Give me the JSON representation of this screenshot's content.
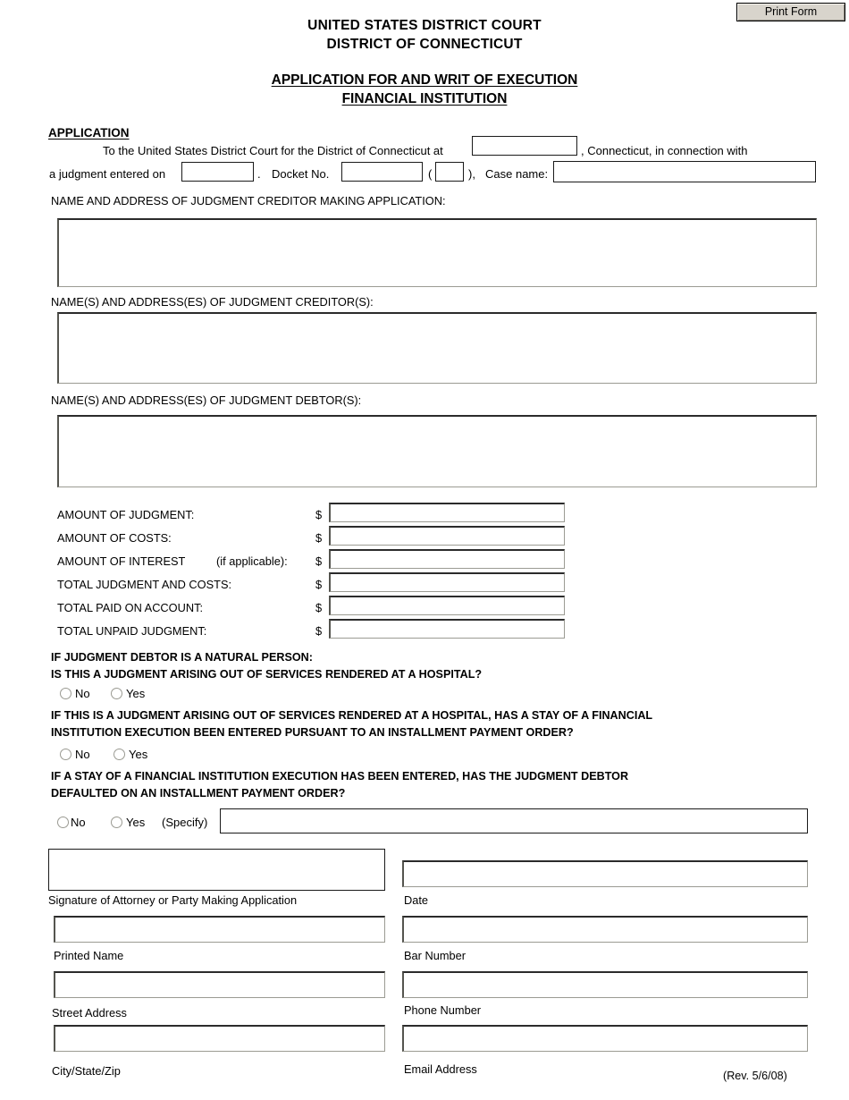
{
  "toolbar": {
    "print_form_label": "Print Form"
  },
  "header": {
    "court_line1": "UNITED STATES DISTRICT COURT",
    "court_line2": "DISTRICT OF CONNECTICUT",
    "form_title_line1": "APPLICATION FOR AND WRIT OF EXECUTION",
    "form_title_line2": "FINANCIAL INSTITUTION"
  },
  "application": {
    "section_heading": "APPLICATION",
    "intro_text": "To the United States District Court for the District of Connecticut at",
    "intro_after_city": ", Connecticut, in connection with",
    "judgment_entered_label": "a judgment entered on",
    "period": ".",
    "docket_label": "Docket No.",
    "paren_open": "(",
    "paren_close": "),",
    "case_name_label": "Case name:",
    "city_value": "",
    "judgment_date_value": "",
    "docket_no_value": "",
    "docket_suffix_value": "",
    "case_name_value": ""
  },
  "parties": {
    "creditor_applicant_label": "NAME AND ADDRESS OF JUDGMENT CREDITOR MAKING APPLICATION:",
    "creditor_applicant_value": "",
    "creditors_label": "NAME(S) AND ADDRESS(ES) OF JUDGMENT CREDITOR(S):",
    "creditors_value": "",
    "debtors_label": "NAME(S) AND ADDRESS(ES) OF JUDGMENT DEBTOR(S):",
    "debtors_value": ""
  },
  "amounts": {
    "currency_symbol": "$",
    "rows": [
      {
        "label": "AMOUNT OF JUDGMENT:",
        "note": "",
        "value": ""
      },
      {
        "label": "AMOUNT OF COSTS:",
        "note": "",
        "value": ""
      },
      {
        "label": "AMOUNT OF INTEREST",
        "note": "(if applicable):",
        "value": ""
      },
      {
        "label": "TOTAL JUDGMENT AND COSTS:",
        "note": "",
        "value": ""
      },
      {
        "label": "TOTAL PAID ON ACCOUNT:",
        "note": "",
        "value": ""
      },
      {
        "label": "TOTAL UNPAID JUDGMENT:",
        "note": "",
        "value": ""
      }
    ]
  },
  "questions": {
    "q1_line1": "IF JUDGMENT DEBTOR IS A NATURAL PERSON:",
    "q1_line2": "IS THIS A JUDGMENT ARISING OUT OF SERVICES RENDERED AT A HOSPITAL?",
    "q1_no": "No",
    "q1_yes": "Yes",
    "q2_line1": "IF THIS IS A JUDGMENT ARISING OUT OF SERVICES RENDERED AT A HOSPITAL, HAS A STAY OF A FINANCIAL",
    "q2_line2": "INSTITUTION EXECUTION BEEN ENTERED PURSUANT TO AN INSTALLMENT PAYMENT ORDER?",
    "q2_no": "No",
    "q2_yes": "Yes",
    "q3_line1": "IF A STAY OF A FINANCIAL INSTITUTION EXECUTION HAS BEEN ENTERED, HAS THE JUDGMENT DEBTOR",
    "q3_line2": "DEFAULTED ON AN INSTALLMENT PAYMENT ORDER?",
    "q3_no": "No",
    "q3_yes": "Yes",
    "q3_specify_label": "(Specify)",
    "q3_specify_value": ""
  },
  "signature_block": {
    "signature_label": "Signature of Attorney or Party Making Application",
    "signature_value": "",
    "date_label": "Date",
    "date_value": "",
    "printed_name_label": "Printed Name",
    "printed_name_value": "",
    "bar_number_label": "Bar Number",
    "bar_number_value": "",
    "street_address_label": "Street Address",
    "street_address_value": "",
    "phone_number_label": "Phone Number",
    "phone_number_value": "",
    "city_state_zip_label": "City/State/Zip",
    "city_state_zip_value": "",
    "email_address_label": "Email Address",
    "email_address_value": ""
  },
  "footer": {
    "revision": "(Rev. 5/6/08)"
  }
}
